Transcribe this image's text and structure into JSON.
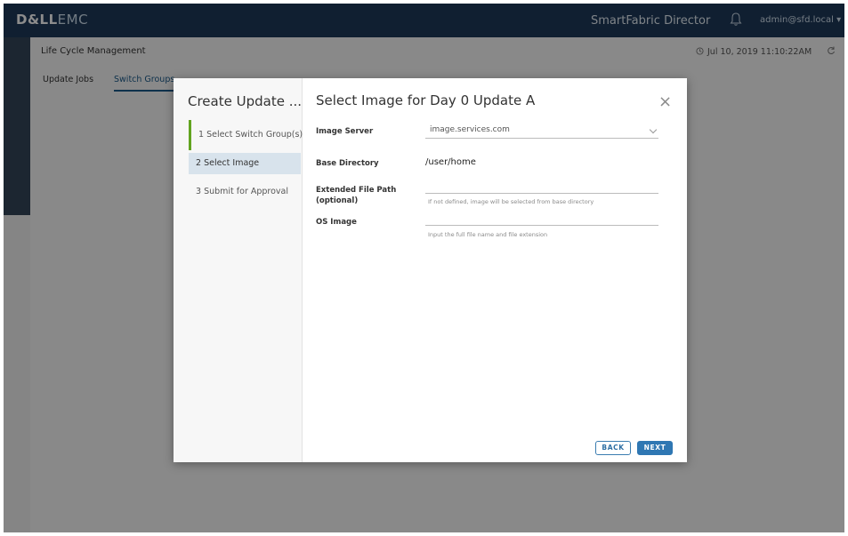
{
  "app": {
    "brand_dell": "D&LL",
    "brand_emc": "EMC",
    "product_name": "SmartFabric Director",
    "user": "admin@sfd.local ▾",
    "page_title": "Life Cycle Management",
    "timestamp": "Jul 10, 2019 11:10:22AM",
    "tabs": [
      {
        "label": "Update Jobs"
      },
      {
        "label": "Switch Groups"
      }
    ]
  },
  "wizard": {
    "title": "Create Update ...",
    "steps": [
      {
        "label": "1  Select Switch Group(s)",
        "state": "done"
      },
      {
        "label": "2  Select Image",
        "state": "active"
      },
      {
        "label": "3  Submit for Approval",
        "state": "todo"
      }
    ]
  },
  "dialog": {
    "title": "Select Image for Day 0 Update A",
    "close_glyph": "×",
    "fields": {
      "image_server": {
        "label": "Image Server",
        "value": "image.services.com"
      },
      "base_directory": {
        "label": "Base Directory",
        "value": "/user/home"
      },
      "extended_path": {
        "label_line1": "Extended File Path",
        "label_line2": "(optional)",
        "value": "",
        "hint": "If not defined, image will be selected from base directory"
      },
      "os_image": {
        "label": "OS Image",
        "value": "",
        "hint": "Input the full file name and file extension"
      }
    },
    "buttons": {
      "back": "BACK",
      "next": "NEXT"
    }
  },
  "colors": {
    "topbar": "#1e3a5a",
    "accent": "#2f77b3",
    "progress_green": "#62a420",
    "active_step": "#d8e3ec"
  },
  "icons": [
    "bell-icon",
    "clock-icon",
    "refresh-icon",
    "close-icon",
    "chevron-down-icon"
  ]
}
